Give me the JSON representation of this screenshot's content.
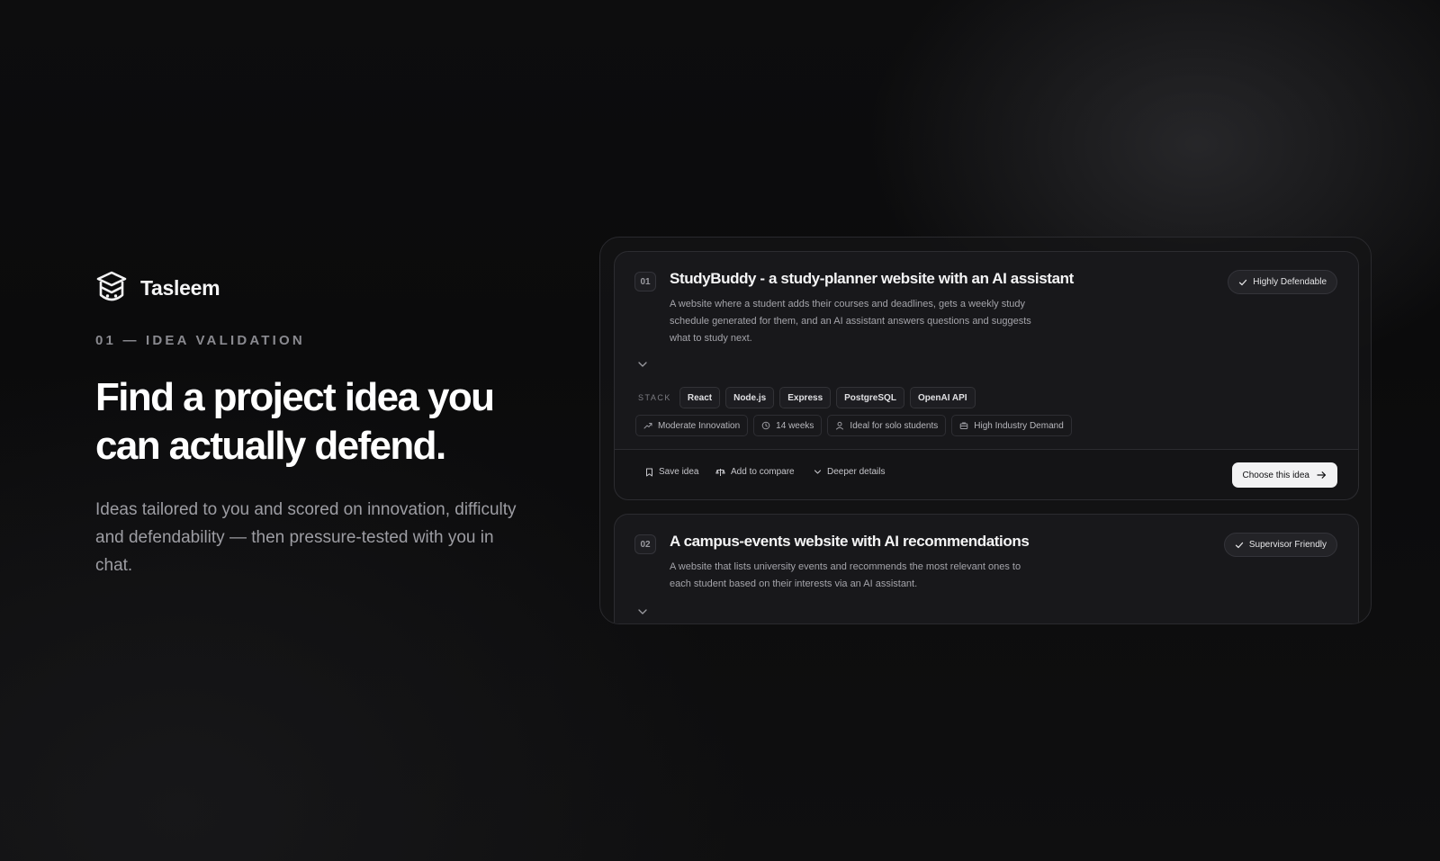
{
  "brand": {
    "name": "Tasleem",
    "icon": "graduation-cap-icon"
  },
  "eyebrow": "01 — IDEA VALIDATION",
  "headline": "Find a project idea you can actually defend.",
  "lede": "Ideas tailored to you and scored on innovation, difficulty and defendability — then pressure-tested with you in chat.",
  "ideas": [
    {
      "number": "01",
      "title": "StudyBuddy - a study-planner website with an AI assistant",
      "description": "A website where a student adds their courses and deadlines, gets a weekly study schedule generated for them, and an AI assistant answers questions and suggests what to study next.",
      "badge": "Highly Defendable",
      "stack_label": "STACK",
      "stack": [
        "React",
        "Node.js",
        "Express",
        "PostgreSQL",
        "OpenAI API"
      ],
      "meta": {
        "innovation": "Moderate Innovation",
        "duration": "14 weeks",
        "team": "Ideal for solo students",
        "demand": "High Industry Demand"
      },
      "actions": {
        "save": "Save idea",
        "compare": "Add to compare",
        "details": "Deeper details",
        "choose": "Choose this idea"
      }
    },
    {
      "number": "02",
      "title": "A campus-events website with AI recommendations",
      "description": "A website that lists university events and recommends the most relevant ones to each student based on their interests via an AI assistant.",
      "badge": "Supervisor Friendly"
    }
  ],
  "colors": {
    "background": "#0c0c0d",
    "card": "#18181b",
    "accent_button": "#f2f2f3"
  }
}
